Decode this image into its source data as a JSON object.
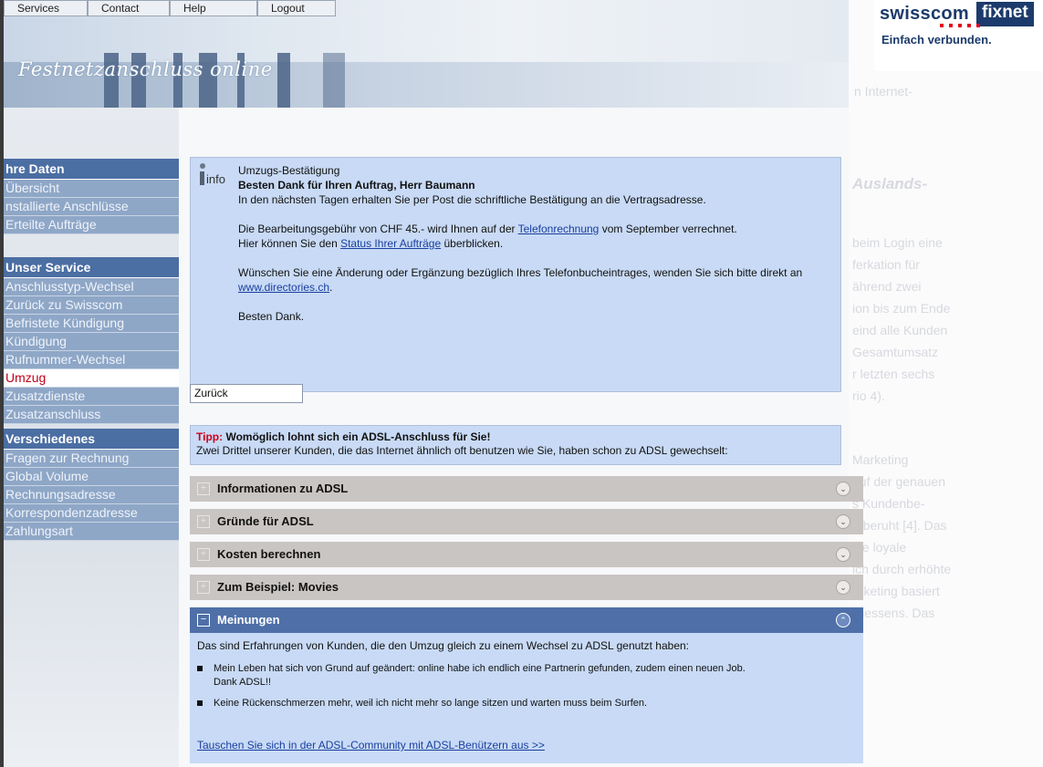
{
  "topnav": [
    "Services",
    "Contact",
    "Help",
    "Logout"
  ],
  "brand": {
    "title": "Festnetzanschluss online",
    "logo_left": "swisscom",
    "logo_right": "fixnet",
    "tagline": "Einfach verbunden."
  },
  "sidebar": {
    "groups": [
      {
        "title": "hre Daten",
        "items": [
          "Übersicht",
          "nstallierte Anschlüsse",
          "Erteilte Aufträge"
        ]
      },
      {
        "title": "Unser Service",
        "items": [
          "Anschlusstyp-Wechsel",
          "Zurück zu Swisscom",
          "Befristete Kündigung",
          "Kündigung",
          "Rufnummer-Wechsel",
          "Umzug",
          "Zusatzdienste",
          "Zusatzanschluss"
        ]
      },
      {
        "title": "Verschiedenes",
        "items": [
          "Fragen zur Rechnung",
          "Global Volume",
          "Rechnungsadresse",
          "Korrespondenzadresse",
          "Zahlungsart"
        ]
      }
    ],
    "active_item": "Umzug"
  },
  "info": {
    "icon_label": "info",
    "heading": "Umzugs-Bestätigung",
    "thanks": "Besten Dank für Ihren Auftrag, Herr Baumann",
    "line1": "In den nächsten Tagen erhalten Sie per Post die schriftliche Bestätigung an die Vertragsadresse.",
    "fee_pre": "Die Bearbeitungsgebühr von CHF 45.- wird Ihnen auf der ",
    "fee_link": "Telefonrechnung",
    "fee_post": " vom September verrechnet.",
    "status_pre": "Hier können Sie den ",
    "status_link": "Status Ihrer Aufträge",
    "status_post": " überblicken.",
    "dir_pre": "Wünschen Sie eine Änderung oder Ergänzung bezüglich Ihres Telefonbucheintrages, wenden Sie sich bitte direkt an ",
    "dir_link": "www.directories.ch",
    "dir_post": ".",
    "closing": "Besten Dank."
  },
  "back_button": "Zurück",
  "tip": {
    "label": "Tipp:",
    "headline": "Womöglich lohnt sich ein ADSL-Anschluss für Sie!",
    "text": "Zwei Drittel unserer Kunden, die das Internet ähnlich oft benutzen wie Sie, haben schon zu ADSL gewechselt:"
  },
  "accordion": [
    {
      "label": "Informationen zu ADSL",
      "open": false
    },
    {
      "label": "Gründe für ADSL",
      "open": false
    },
    {
      "label": "Kosten berechnen",
      "open": false
    },
    {
      "label": "Zum Beispiel: Movies",
      "open": false
    },
    {
      "label": "Meinungen",
      "open": true
    }
  ],
  "opinions": {
    "intro": "Das sind Erfahrungen von Kunden, die den Umzug gleich zu einem Wechsel zu ADSL genutzt haben:",
    "items": [
      "Mein Leben hat sich von Grund auf geändert: online habe ich endlich eine Partnerin gefunden, zudem einen neuen Job. Dank ADSL!!",
      "Keine Rückenschmerzen mehr, weil ich nicht mehr so lange sitzen und warten muss beim Surfen."
    ],
    "link": "Tauschen Sie sich in der ADSL-Community mit ADSL-Benützern aus >>"
  },
  "background_text": [
    "n Internet-",
    "Auslands-",
    "beim Login eine",
    "ferkation für",
    "ährend zwei",
    "ion bis zum Ende",
    "eind alle Kunden",
    "Gesamtumsatz",
    "r letzten sechs",
    "rio 4).",
    "Marketing",
    "auf der genauen",
    "s Kundenbe-",
    "n beruht [4]. Das",
    "ige loyale",
    "ich durch erhöhte",
    "arketing basiert",
    "wiessens. Das"
  ]
}
